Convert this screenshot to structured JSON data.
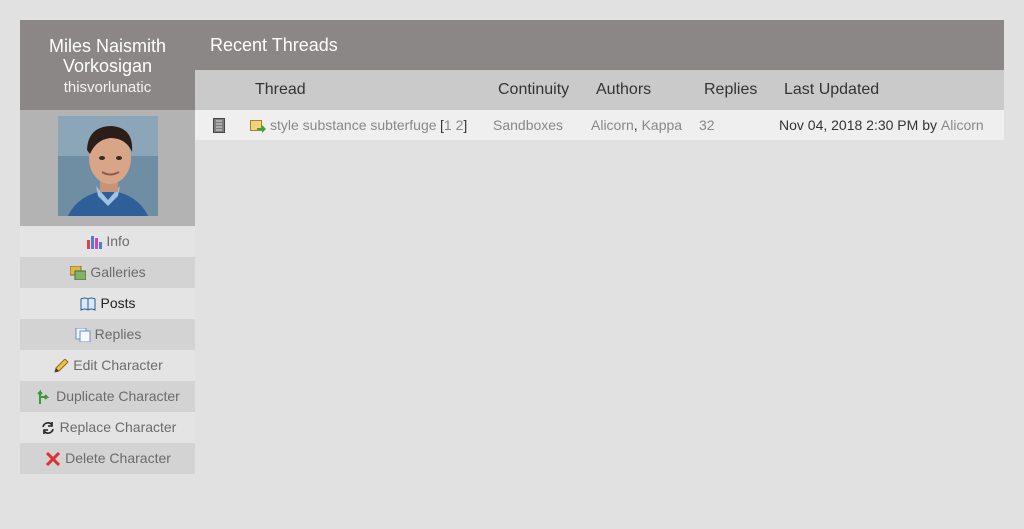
{
  "character": {
    "name_line1": "Miles Naismith",
    "name_line2": "Vorkosigan",
    "screenname": "thisvorlunatic"
  },
  "sidebar": {
    "items": [
      {
        "label": "Info",
        "icon": "chart-icon"
      },
      {
        "label": "Galleries",
        "icon": "galleries-icon"
      },
      {
        "label": "Posts",
        "icon": "book-icon"
      },
      {
        "label": "Replies",
        "icon": "replies-icon"
      },
      {
        "label": "Edit Character",
        "icon": "pencil-icon"
      },
      {
        "label": "Duplicate Character",
        "icon": "duplicate-icon"
      },
      {
        "label": "Replace Character",
        "icon": "refresh-icon"
      },
      {
        "label": "Delete Character",
        "icon": "delete-icon"
      }
    ]
  },
  "threads": {
    "title": "Recent Threads",
    "columns": {
      "thread": "Thread",
      "continuity": "Continuity",
      "authors": "Authors",
      "replies": "Replies",
      "last_updated": "Last Updated"
    },
    "rows": [
      {
        "title": "style substance subterfuge",
        "page_open": "[",
        "page1": "1",
        "page2": "2",
        "page_close": "]",
        "continuity": "Sandboxes",
        "author1": "Alicorn",
        "author_sep": ",",
        "author2": "Kappa",
        "replies": "32",
        "updated_time": "Nov 04, 2018 2:30 PM",
        "updated_by": "by",
        "updated_user": "Alicorn"
      }
    ]
  },
  "colors": {
    "header_bg": "#8c8787",
    "page_bg": "#e1e1e1",
    "table_header_bg": "#cacaca"
  }
}
